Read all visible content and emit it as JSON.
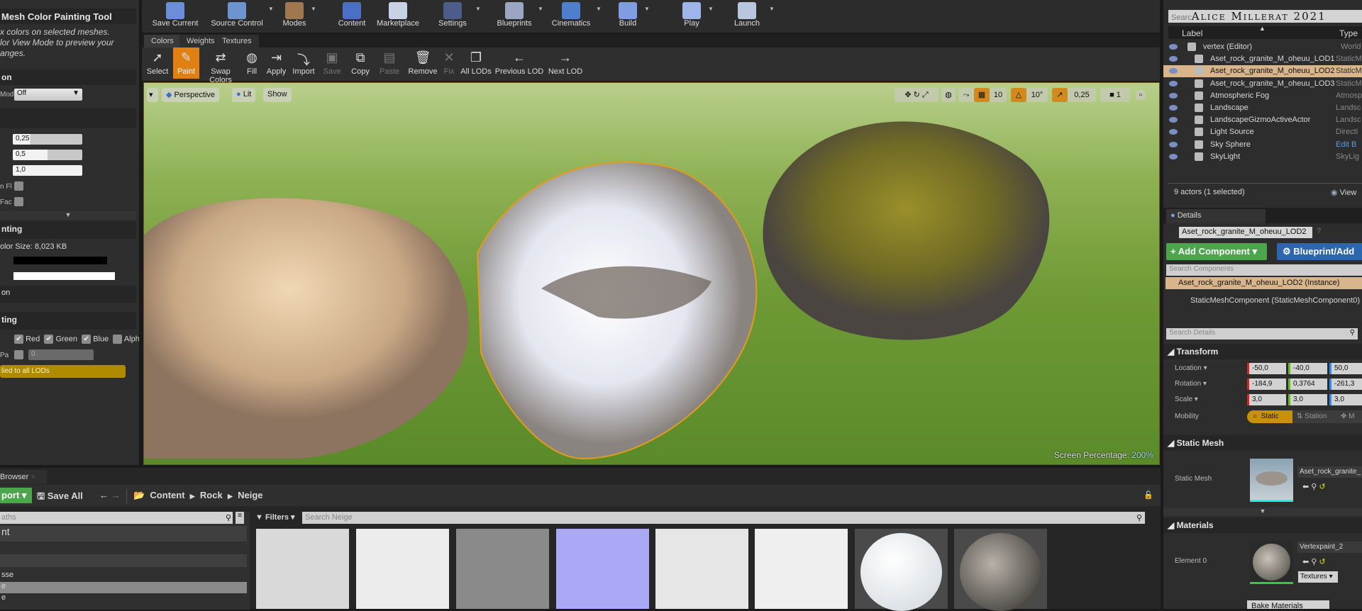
{
  "left_panel": {
    "title": "Mesh Color Painting Tool",
    "desc": [
      "x colors on selected meshes.",
      "lor View Mode to preview your",
      "anges."
    ],
    "sec1": "on",
    "mod_label": "Mod",
    "mod_value": "Off",
    "sliders": [
      "0,25",
      "0,5",
      "1,0"
    ],
    "slider_fill": [
      0.25,
      0.5,
      1.0
    ],
    "chk1_label": "n Fl",
    "chk2_label": "Fac",
    "sec2": "nting",
    "size": "olor Size: 8,023 KB",
    "sec3": "on",
    "sec4": "ting",
    "channels": [
      "Red",
      "Green",
      "Blue",
      "Alpha"
    ],
    "pa_label": "Pa",
    "pa_value": "0",
    "lod_banner": "lied to all LODs"
  },
  "toolbar": [
    {
      "label": "Save Current",
      "icon": "save-icon"
    },
    {
      "label": "Source Control",
      "icon": "source-control-icon"
    },
    {
      "label": "Modes",
      "icon": "modes-icon"
    },
    {
      "label": "Content",
      "icon": "content-icon"
    },
    {
      "label": "Marketplace",
      "icon": "marketplace-icon"
    },
    {
      "label": "Settings",
      "icon": "settings-icon"
    },
    {
      "label": "Blueprints",
      "icon": "blueprints-icon"
    },
    {
      "label": "Cinematics",
      "icon": "cinematics-icon"
    },
    {
      "label": "Build",
      "icon": "build-icon"
    },
    {
      "label": "Play",
      "icon": "play-icon"
    },
    {
      "label": "Launch",
      "icon": "launch-icon"
    }
  ],
  "mode_tabs": [
    "Colors",
    "Weights",
    "Textures"
  ],
  "paint_tools": [
    {
      "label": "Select",
      "glyph": "➚"
    },
    {
      "label": "Paint",
      "glyph": "✎",
      "active": true
    },
    {
      "label": "Swap Colors",
      "glyph": "⇄"
    },
    {
      "label": "Fill",
      "glyph": "◍"
    },
    {
      "label": "Apply",
      "glyph": "⇥"
    },
    {
      "label": "Import",
      "glyph": "⤵"
    },
    {
      "label": "Save",
      "glyph": "▣",
      "disabled": true
    },
    {
      "label": "Copy",
      "glyph": "⧉"
    },
    {
      "label": "Paste",
      "glyph": "▤",
      "disabled": true
    },
    {
      "label": "Remove",
      "glyph": "🗑"
    },
    {
      "label": "Fix",
      "glyph": "✕",
      "disabled": true
    },
    {
      "label": "All LODs",
      "glyph": "❐"
    },
    {
      "label": "Previous LOD",
      "glyph": "←"
    },
    {
      "label": "Next LOD",
      "glyph": "→"
    }
  ],
  "viewport": {
    "perspective": "Perspective",
    "lit": "Lit",
    "show": "Show",
    "grid": "10",
    "angle": "10°",
    "scale": "0,25",
    "camera_speed": "1",
    "screen_pct_label": "Screen Percentage:",
    "screen_pct": "200%"
  },
  "outliner": {
    "search": "Searc",
    "watermark": "Alice Millerat 2021",
    "col_label": "Label",
    "col_type": "Type",
    "rows": [
      {
        "label": "vertex (Editor)",
        "type": "World"
      },
      {
        "label": "Aset_rock_granite_M_oheuu_LOD1",
        "type": "StaticM"
      },
      {
        "label": "Aset_rock_granite_M_oheuu_LOD2",
        "type": "StaticM",
        "selected": true
      },
      {
        "label": "Aset_rock_granite_M_oheuu_LOD3",
        "type": "StaticM"
      },
      {
        "label": "Atmospheric Fog",
        "type": "Atmosp"
      },
      {
        "label": "Landscape",
        "type": "Landsc"
      },
      {
        "label": "LandscapeGizmoActiveActor",
        "type": "Landsc"
      },
      {
        "label": "Light Source",
        "type": "Directi"
      },
      {
        "label": "Sky Sphere",
        "type": "Edit B"
      },
      {
        "label": "SkyLight",
        "type": "SkyLig"
      }
    ],
    "status": "9 actors (1 selected)",
    "view": "View"
  },
  "details": {
    "tab": "Details",
    "name": "Aset_rock_granite_M_oheuu_LOD2",
    "add_component": "+ Add Component",
    "blueprint": "Blueprint/Add",
    "search_components": "Search Components",
    "instance": "Aset_rock_granite_M_oheuu_LOD2 (Instance)",
    "component": "StaticMeshComponent (StaticMeshComponent0)",
    "search_details": "Search Details",
    "transform": "Transform",
    "location": {
      "label": "Location",
      "x": "-50,0",
      "y": "-40,0",
      "z": "50,0"
    },
    "rotation": {
      "label": "Rotation",
      "x": "-184,9",
      "y": "0,3764",
      "z": "-261,3"
    },
    "scale": {
      "label": "Scale",
      "x": "3,0",
      "y": "3,0",
      "z": "3,0"
    },
    "mobility": {
      "label": "Mobility",
      "static": "Static",
      "stationary": "Station",
      "movable": "M"
    },
    "static_mesh_header": "Static Mesh",
    "static_mesh_label": "Static Mesh",
    "static_mesh_value": "Aset_rock_granite_",
    "materials_header": "Materials",
    "element_label": "Element 0",
    "element_value": "Vertexpaint_2",
    "textures": "Textures",
    "bake": "Bake Materials"
  },
  "browser": {
    "tab": "Browser",
    "import": "port",
    "save_all": "Save All",
    "breadcrumb": [
      "Content",
      "Rock",
      "Neige"
    ],
    "paths_placeholder": "aths",
    "filters": "Filters",
    "search_placeholder": "Search Neige",
    "tree": [
      "nt",
      "",
      "",
      "sse",
      "e",
      "e"
    ],
    "thumb_colors": [
      "#d9d9d9",
      "#ececec",
      "#8a8a8a",
      "#a9a9f5",
      "#e6e6e6",
      "#efefef",
      "#e8e8e8",
      "#6e6a64"
    ]
  }
}
